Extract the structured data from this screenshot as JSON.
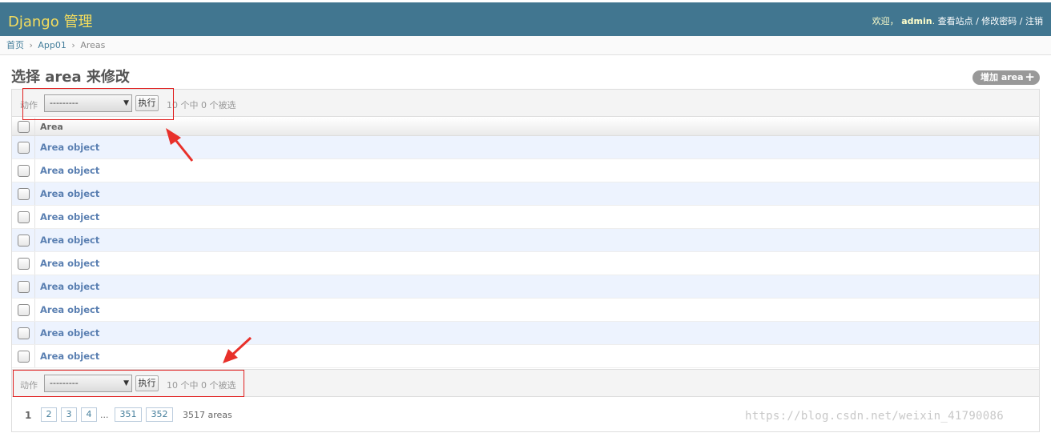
{
  "header": {
    "branding": "Django 管理",
    "welcome": "欢迎，",
    "username": "admin",
    "view_site": "查看站点",
    "change_password": "修改密码",
    "logout": "注销",
    "separator": "/",
    "colors": {
      "header_bg": "#417690",
      "branding": "#f5dd5d"
    }
  },
  "breadcrumbs": {
    "home": "首页",
    "app": "App01",
    "current": "Areas",
    "separator": "›"
  },
  "page": {
    "title": "选择 area 来修改",
    "add_button": "增加 area"
  },
  "actions": {
    "label": "动作",
    "select_value": "---------",
    "go_button": "执行",
    "selected_count": "10 个中 0 个被选"
  },
  "table": {
    "column_header": "Area",
    "rows": [
      {
        "label": "Area object"
      },
      {
        "label": "Area object"
      },
      {
        "label": "Area object"
      },
      {
        "label": "Area object"
      },
      {
        "label": "Area object"
      },
      {
        "label": "Area object"
      },
      {
        "label": "Area object"
      },
      {
        "label": "Area object"
      },
      {
        "label": "Area object"
      },
      {
        "label": "Area object"
      }
    ]
  },
  "paginator": {
    "current": "1",
    "pages": [
      "2",
      "3",
      "4",
      "351",
      "352"
    ],
    "ellipsis": "...",
    "total": "3517 areas"
  },
  "watermark": "https://blog.csdn.net/weixin_41790086"
}
